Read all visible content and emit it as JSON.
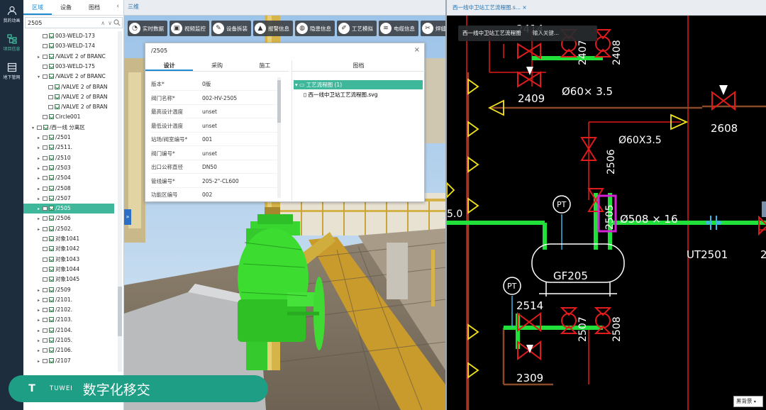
{
  "rail": {
    "items": [
      {
        "label": "我的动画",
        "icon": "user-icon"
      },
      {
        "label": "项目信息",
        "icon": "project-tree-icon",
        "active": true
      },
      {
        "label": "地下管网",
        "icon": "pipe-network-icon"
      }
    ]
  },
  "tree": {
    "tabs": [
      "区域",
      "设备",
      "图档"
    ],
    "active_tab": 0,
    "search_value": "2505",
    "rows": [
      {
        "label": "003-WELD-173",
        "indent": 2,
        "arrow": "",
        "folder": true
      },
      {
        "label": "003-WELD-174",
        "indent": 2,
        "arrow": "",
        "folder": true
      },
      {
        "label": "/VALVE 2 of BRANC",
        "indent": 2,
        "arrow": "▸",
        "folder": true
      },
      {
        "label": "003-WELD-175",
        "indent": 2,
        "arrow": "",
        "folder": true
      },
      {
        "label": "/VALVE 2 of BRANC",
        "indent": 2,
        "arrow": "▾",
        "folder": true
      },
      {
        "label": "/VALVE 2 of BRAN",
        "indent": 3,
        "arrow": "",
        "folder": true
      },
      {
        "label": "/VALVE 2 of BRAN",
        "indent": 3,
        "arrow": "",
        "folder": true
      },
      {
        "label": "/VALVE 2 of BRAN",
        "indent": 3,
        "arrow": "",
        "folder": true
      },
      {
        "label": "Circle001",
        "indent": 2,
        "arrow": "",
        "folder": true
      },
      {
        "label": "/西一线 分离区",
        "indent": 1,
        "arrow": "▾",
        "folder": true
      },
      {
        "label": "/2501",
        "indent": 2,
        "arrow": "▸",
        "folder": true
      },
      {
        "label": "/2511.",
        "indent": 2,
        "arrow": "▸",
        "folder": true
      },
      {
        "label": "/2510",
        "indent": 2,
        "arrow": "▸",
        "folder": true
      },
      {
        "label": "/2503",
        "indent": 2,
        "arrow": "▸",
        "folder": true
      },
      {
        "label": "/2504",
        "indent": 2,
        "arrow": "▸",
        "folder": true
      },
      {
        "label": "/2508",
        "indent": 2,
        "arrow": "▸",
        "folder": true
      },
      {
        "label": "/2507",
        "indent": 2,
        "arrow": "▸",
        "folder": true
      },
      {
        "label": "/2505",
        "indent": 2,
        "arrow": "▸",
        "folder": true,
        "selected": true
      },
      {
        "label": "/2506",
        "indent": 2,
        "arrow": "▸",
        "folder": true
      },
      {
        "label": "/2502.",
        "indent": 2,
        "arrow": "▸",
        "folder": true
      },
      {
        "label": "对象1041",
        "indent": 2,
        "arrow": "",
        "folder": true
      },
      {
        "label": "对象1042",
        "indent": 2,
        "arrow": "",
        "folder": true
      },
      {
        "label": "对象1043",
        "indent": 2,
        "arrow": "",
        "folder": true
      },
      {
        "label": "对象1044",
        "indent": 2,
        "arrow": "",
        "folder": true
      },
      {
        "label": "对象1045",
        "indent": 2,
        "arrow": "",
        "folder": true
      },
      {
        "label": "/2509",
        "indent": 2,
        "arrow": "▸",
        "folder": true
      },
      {
        "label": "/2101.",
        "indent": 2,
        "arrow": "▸",
        "folder": true
      },
      {
        "label": "/2102.",
        "indent": 2,
        "arrow": "▸",
        "folder": true
      },
      {
        "label": "/2103.",
        "indent": 2,
        "arrow": "▸",
        "folder": true
      },
      {
        "label": "/2104.",
        "indent": 2,
        "arrow": "▸",
        "folder": true
      },
      {
        "label": "/2105.",
        "indent": 2,
        "arrow": "▸",
        "folder": true
      },
      {
        "label": "/2106.",
        "indent": 2,
        "arrow": "▸",
        "folder": true
      },
      {
        "label": "/2107",
        "indent": 2,
        "arrow": "▸",
        "folder": true
      }
    ]
  },
  "viewer": {
    "tab": "三维",
    "toolbar": [
      {
        "label": "实时数据",
        "icon": "chart-icon"
      },
      {
        "label": "视频监控",
        "icon": "camera-icon"
      },
      {
        "label": "设备拆装",
        "icon": "wrench-icon"
      },
      {
        "label": "报警信息",
        "icon": "warning-icon"
      },
      {
        "label": "隐患信息",
        "icon": "hazard-icon"
      },
      {
        "label": "工艺模拟",
        "icon": "process-icon"
      },
      {
        "label": "电缆信息",
        "icon": "cable-icon"
      },
      {
        "label": "焊缝信",
        "icon": "weld-icon"
      }
    ]
  },
  "dialog": {
    "title": "/2505",
    "tabs": [
      "设计",
      "采购",
      "施工"
    ],
    "active_tab": 0,
    "props": [
      {
        "k": "版本*",
        "v": "0版"
      },
      {
        "k": "阀门名称*",
        "v": "002-HV-2505"
      },
      {
        "k": "最高设计温度",
        "v": "unset"
      },
      {
        "k": "最低设计温度",
        "v": "unset"
      },
      {
        "k": "站场/阀室编号*",
        "v": "001"
      },
      {
        "k": "阀门编号*",
        "v": "unset"
      },
      {
        "k": "出口公称直径",
        "v": "DN50"
      },
      {
        "k": "管线编号*",
        "v": "205-2\"-CL600"
      },
      {
        "k": "功能区编号",
        "v": "002"
      }
    ],
    "docs_header": "图档",
    "docs": [
      {
        "label": "工艺流程图 (1)",
        "selected": true
      },
      {
        "label": "西一线中卫站工艺流程图.svg",
        "selected": false
      }
    ]
  },
  "pid": {
    "tab": "西一线中卫站工艺流程图.s...",
    "tab_close": "×",
    "mini_tab": "西一线中卫站工艺流程图",
    "search_hint": "输入关键...",
    "labels": [
      "2414",
      "2407",
      "2408",
      "2409",
      "Ø60× 3.5",
      "2608",
      "Ø60X3.5",
      "2506",
      "PT",
      "2505",
      "Ø508 × 16",
      "UT2501",
      "5.0",
      "GF205",
      "PT",
      "2514",
      "2507",
      "2508",
      "2309",
      "2"
    ],
    "background_select": "黑背景"
  },
  "brand": {
    "logo": "T",
    "name": "TUWEI",
    "slogan": "数字化移交"
  },
  "colors": {
    "pipe_green": "#22e03a",
    "valve_red": "#e01b1b",
    "arrow_yellow": "#f2e21a",
    "highlight_magenta": "#d61fd6",
    "accent": "#3fb79a"
  }
}
